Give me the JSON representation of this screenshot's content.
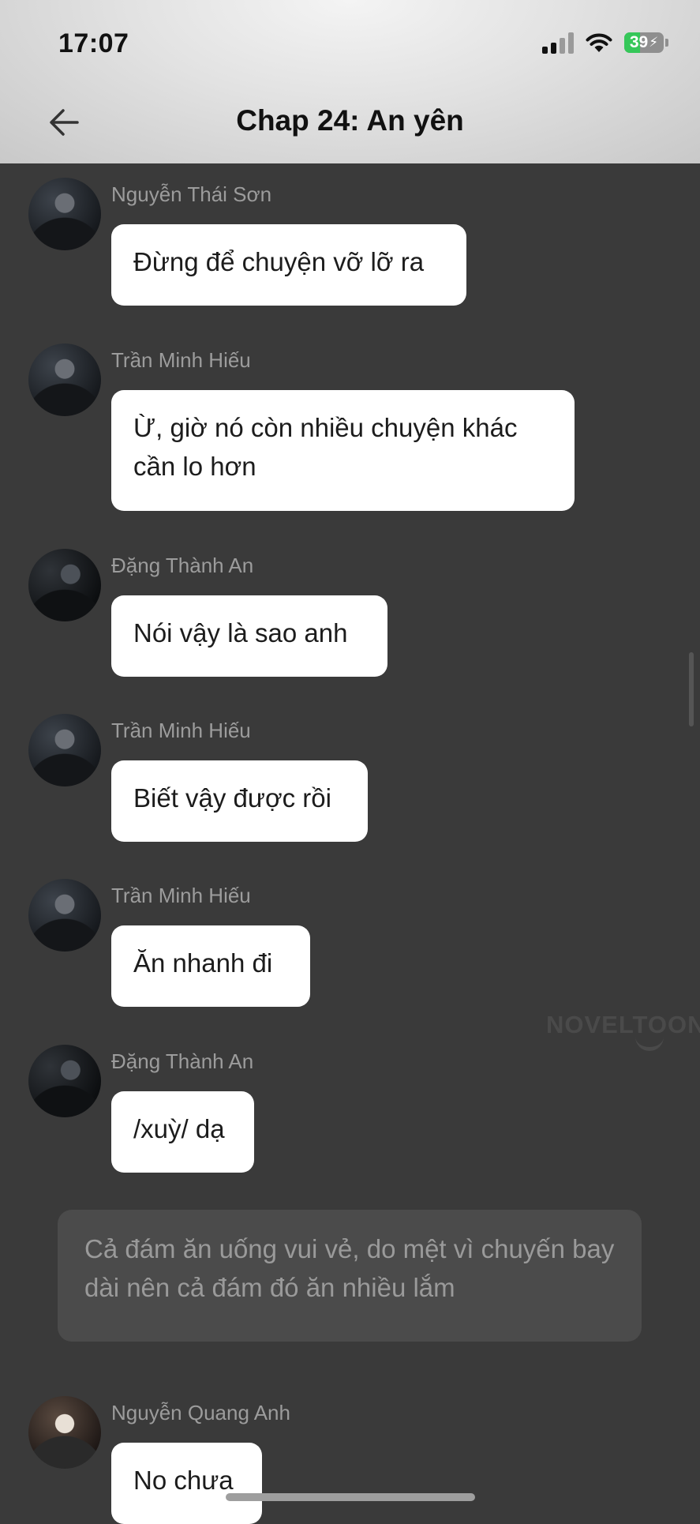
{
  "status_bar": {
    "time": "17:07",
    "battery": "39",
    "battery_level": 0.39
  },
  "header": {
    "title": "Chap 24: An yên",
    "back_icon": "back-arrow-icon"
  },
  "messages": [
    {
      "name": "Nguyễn Thái Sơn",
      "text": "Đừng để chuyện vỡ lỡ ra"
    },
    {
      "name": "Trần Minh Hiếu",
      "text": "Ừ, giờ nó còn nhiều chuyện khác cần lo hơn"
    },
    {
      "name": "Đặng Thành An",
      "text": "Nói vậy là sao anh"
    },
    {
      "name": "Trần Minh Hiếu",
      "text": "Biết vậy được rồi"
    },
    {
      "name": "Trần Minh Hiếu",
      "text": "Ăn nhanh đi"
    },
    {
      "name": "Đặng Thành An",
      "text": "/xuỳ/ dạ"
    }
  ],
  "narration": "Cả đám ăn uống vui vẻ, do mệt vì chuyến bay dài nên cả đám đó ăn nhiều lắm",
  "last_message": {
    "name": "Nguyễn Quang Anh",
    "text": "No chưa"
  },
  "watermark": "NOVELTOON",
  "colors": {
    "background": "#3a3a3a",
    "bubble": "#ffffff",
    "narration_bg": "#4b4b4b",
    "battery_green": "#35c759"
  }
}
